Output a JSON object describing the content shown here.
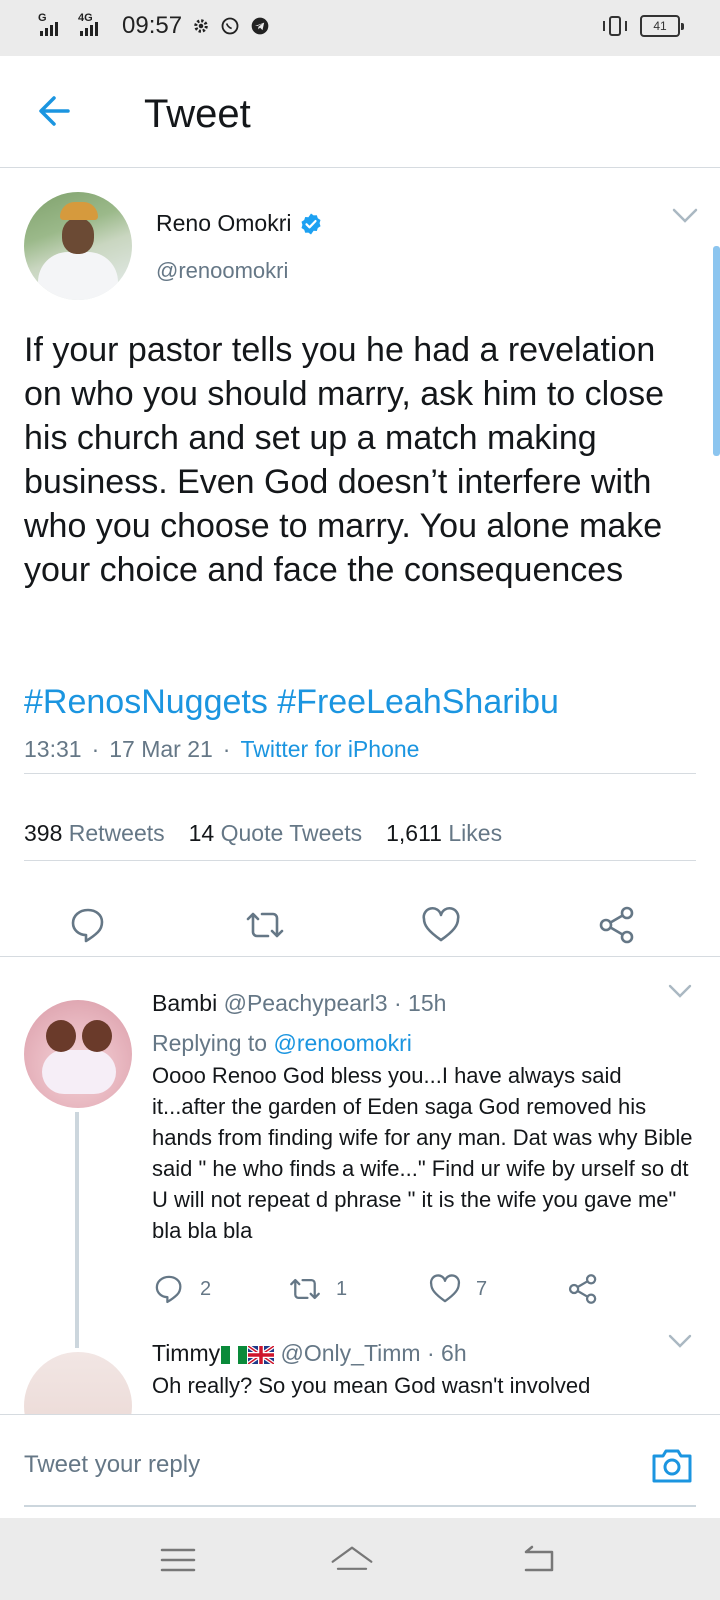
{
  "status_bar": {
    "signal1_label": "G",
    "signal2_label": "4G",
    "time": "09:57",
    "battery": "41",
    "icons": [
      "settings-gear-icon",
      "whatsapp-icon",
      "telegram-icon",
      "vibrate-icon",
      "battery-icon"
    ]
  },
  "header": {
    "title": "Tweet",
    "back_icon": "arrow-left-icon"
  },
  "tweet": {
    "author_name": "Reno Omokri",
    "author_handle": "@renoomokri",
    "verified": true,
    "text": "If your pastor tells you he had a revelation on who you should marry, ask him to close his church and set up a match making business. Even God doesn’t interfere with who you choose to marry. You alone make your choice and face the consequences",
    "hashtags": "#RenosNuggets #FreeLeahSharibu",
    "time": "13:31",
    "date": "17 Mar 21",
    "source": "Twitter for iPhone",
    "dot": "·",
    "stats": {
      "retweets_count": "398",
      "retweets_label": "Retweets",
      "quotes_count": "14",
      "quotes_label": "Quote Tweets",
      "likes_count": "1,611",
      "likes_label": "Likes"
    }
  },
  "replies": [
    {
      "name": "Bambi",
      "handle": "@Peachypearl3",
      "age": "15h",
      "replying_prefix": "Replying to",
      "replying_to": "@renoomokri",
      "text": "Oooo Renoo God bless you...I have always said it...after the garden of Eden saga God removed his hands from finding wife for any man. Dat was why Bible said \" he who finds a wife...\" Find ur wife by urself so dt U will not repeat d phrase \" it is the wife you gave me\" bla bla bla",
      "reply_count": "2",
      "retweet_count": "1",
      "like_count": "7"
    },
    {
      "name": "Timmy",
      "handle": "@Only_Timm",
      "age": "6h",
      "text": "Oh really? So you mean God wasn't involved"
    }
  ],
  "composer": {
    "placeholder": "Tweet your reply"
  },
  "colors": {
    "accent": "#1b95e0",
    "secondary_text": "#657786",
    "divider": "#d6dbe0"
  }
}
